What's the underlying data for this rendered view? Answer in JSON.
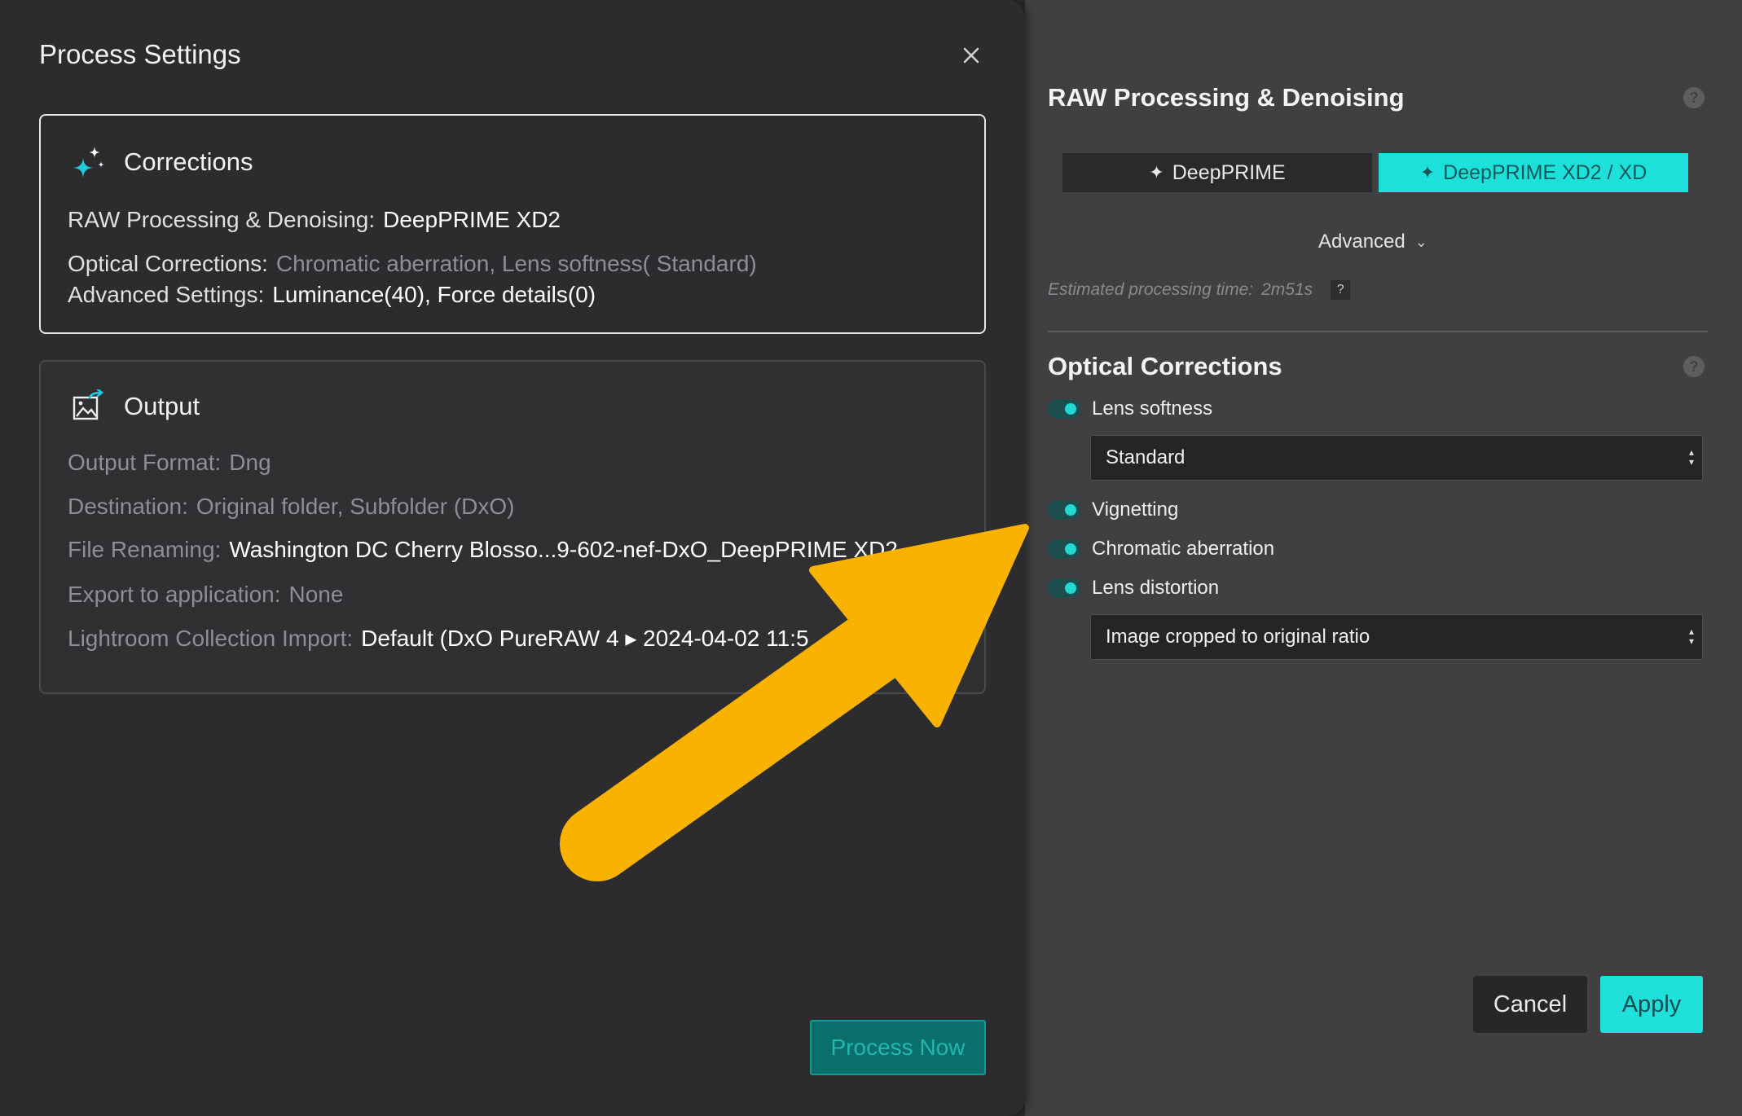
{
  "dialog": {
    "title": "Process Settings",
    "corrections": {
      "heading": "Corrections",
      "raw_label": "RAW Processing & Denoising:",
      "raw_value": "DeepPRIME XD2",
      "optical_label": "Optical Corrections:",
      "optical_value": "Chromatic aberration, Lens softness( Standard)",
      "advanced_label": "Advanced Settings:",
      "advanced_value": "Luminance(40), Force details(0)"
    },
    "output": {
      "heading": "Output",
      "format_label": "Output Format:",
      "format_value": "Dng",
      "destination_label": "Destination:",
      "destination_value": "Original folder, Subfolder (DxO)",
      "renaming_label": "File Renaming:",
      "renaming_value": "Washington DC Cherry Blosso...9-602-nef-DxO_DeepPRIME XD2",
      "export_label": "Export to application:",
      "export_value": "None",
      "lightroom_label": "Lightroom Collection Import:",
      "lightroom_value": "Default (DxO PureRAW 4 ▸ 2024-04-02 11:5"
    },
    "process_button": "Process Now"
  },
  "panel": {
    "raw_section_title": "RAW Processing & Denoising",
    "mode_options": [
      "DeepPRIME",
      "DeepPRIME XD2 / XD"
    ],
    "selected_mode": "DeepPRIME XD2 / XD",
    "advanced_label": "Advanced",
    "estimate_label": "Estimated processing time:",
    "estimate_value": "2m51s",
    "estimate_help": "?",
    "help_glyph": "?",
    "optical_section_title": "Optical Corrections",
    "toggles": {
      "lens_softness": "Lens softness",
      "vignetting": "Vignetting",
      "chromatic_aberration": "Chromatic aberration",
      "lens_distortion": "Lens distortion"
    },
    "lens_softness_select": "Standard",
    "distortion_select": "Image cropped to original ratio",
    "cancel": "Cancel",
    "apply": "Apply"
  },
  "colors": {
    "accent": "#1fe0db",
    "annotation_arrow": "#f9b200"
  },
  "icons": [
    "close-icon",
    "sparkle-icon",
    "export-image-icon",
    "help-icon",
    "chevron-down-icon",
    "select-arrows-icon"
  ]
}
